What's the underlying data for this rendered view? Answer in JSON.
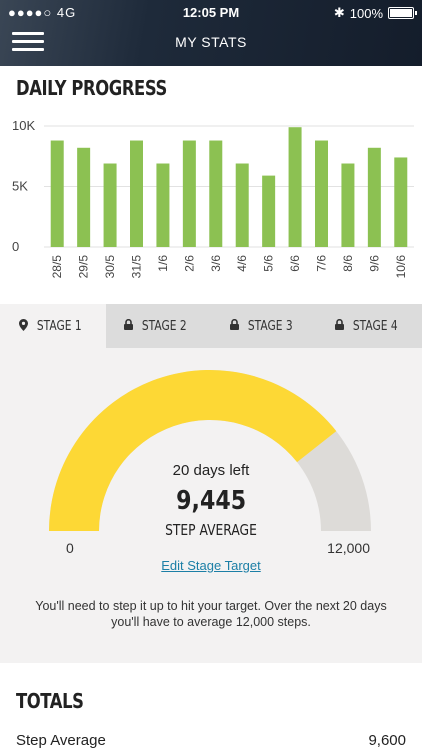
{
  "status_bar": {
    "signal": "●●●●○ 4G",
    "time": "12:05 PM",
    "bluetooth": "✱",
    "battery": "100%"
  },
  "header": {
    "title": "MY STATS",
    "menu_icon": "hamburger-icon"
  },
  "daily_progress": {
    "title": "DAILY PROGRESS"
  },
  "chart_data": {
    "type": "bar",
    "categories": [
      "28/5",
      "29/5",
      "30/5",
      "31/5",
      "1/6",
      "2/6",
      "3/6",
      "4/6",
      "5/6",
      "6/6",
      "7/6",
      "8/6",
      "9/6",
      "10/6"
    ],
    "values": [
      8800,
      8200,
      6900,
      8800,
      6900,
      8800,
      8800,
      6900,
      5900,
      9900,
      8800,
      6900,
      8200,
      7400
    ],
    "yticks": [
      "0",
      "5K",
      "10K"
    ],
    "ylim": [
      0,
      10000
    ],
    "bar_color": "#8cc152",
    "grid": true
  },
  "tabs": [
    {
      "label": "STAGE 1",
      "icon": "location-pin-icon",
      "active": true
    },
    {
      "label": "STAGE 2",
      "icon": "lock-icon",
      "active": false
    },
    {
      "label": "STAGE 3",
      "icon": "lock-icon",
      "active": false
    },
    {
      "label": "STAGE 4",
      "icon": "lock-icon",
      "active": false
    }
  ],
  "stage": {
    "days_left": "20 days left",
    "step_average": "9,445",
    "step_average_label": "STEP AVERAGE",
    "gauge_min": "0",
    "gauge_max": "12,000",
    "gauge_fraction": 0.7871,
    "gauge_fill_color": "#fdd835",
    "gauge_track_color": "#dddbd8",
    "edit_link": "Edit Stage Target",
    "info_text": "You'll need to step it up to hit your target. Over the next 20 days you'll have to average 12,000 steps."
  },
  "totals": {
    "title": "TOTALS",
    "rows": [
      {
        "label": "Step Average",
        "value": "9,600"
      }
    ]
  }
}
